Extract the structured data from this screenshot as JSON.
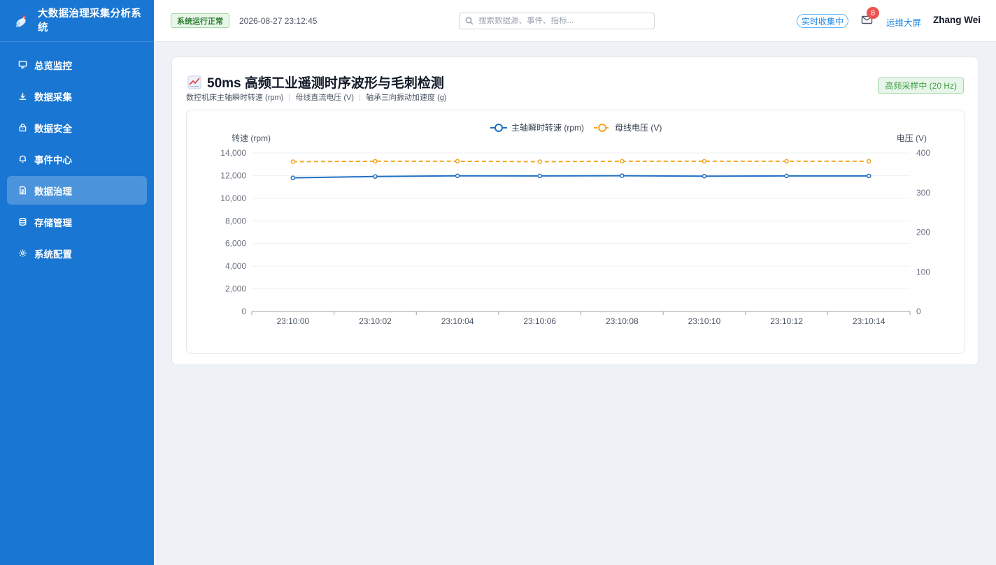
{
  "app": {
    "title": "大数据治理采集分析系统"
  },
  "sidebar": {
    "items": [
      {
        "label": "总览监控",
        "icon": "monitor-icon",
        "active": false
      },
      {
        "label": "数据采集",
        "icon": "download-icon",
        "active": false
      },
      {
        "label": "数据安全",
        "icon": "lock-icon",
        "active": false
      },
      {
        "label": "事件中心",
        "icon": "bell-icon",
        "active": false
      },
      {
        "label": "数据治理",
        "icon": "document-icon",
        "active": true
      },
      {
        "label": "存储管理",
        "icon": "database-icon",
        "active": false
      },
      {
        "label": "系统配置",
        "icon": "gear-icon",
        "active": false
      }
    ]
  },
  "header": {
    "status": "系统运行正常",
    "datetime": "2026-08-27 23:12:45",
    "search_placeholder": "搜索数据源、事件、指标...",
    "realtime_label": "实时收集中",
    "mail_count": "8",
    "ops_link": "运维大屏",
    "user": "Zhang Wei"
  },
  "card": {
    "title": "50ms 高频工业遥测时序波形与毛刺检测",
    "subtitles": [
      "数控机床主轴瞬时转速 (rpm)",
      "母线直流电压 (V)",
      "轴承三向振动加速度 (g)"
    ],
    "badge": "高频采样中 (20 Hz)"
  },
  "colors": {
    "primary": "#1976d2",
    "series1": "#1e6fc4",
    "series2": "#f5a623",
    "success": "#43a047"
  },
  "chart_data": {
    "type": "line",
    "x": [
      "23:10:00",
      "23:10:02",
      "23:10:04",
      "23:10:06",
      "23:10:08",
      "23:10:10",
      "23:10:12",
      "23:10:14"
    ],
    "series": [
      {
        "name": "主轴瞬时转速 (rpm)",
        "axis": "left",
        "style": "solid",
        "values": [
          11800,
          11920,
          11980,
          11970,
          11990,
          11950,
          11970,
          11970
        ]
      },
      {
        "name": "母线电压 (V)",
        "axis": "right",
        "style": "dashed",
        "values": [
          378,
          379,
          379,
          378,
          379,
          379,
          379,
          379
        ]
      }
    ],
    "ylabel_left": "转速 (rpm)",
    "ylabel_right": "电压 (V)",
    "ylim_left": [
      0,
      14000
    ],
    "ylim_right": [
      0,
      400
    ],
    "yticks_left": [
      "0",
      "2,000",
      "4,000",
      "6,000",
      "8,000",
      "10,000",
      "12,000",
      "14,000"
    ],
    "yticks_right": [
      "0",
      "100",
      "200",
      "300",
      "400"
    ],
    "legend": "top-center",
    "grid": true
  }
}
